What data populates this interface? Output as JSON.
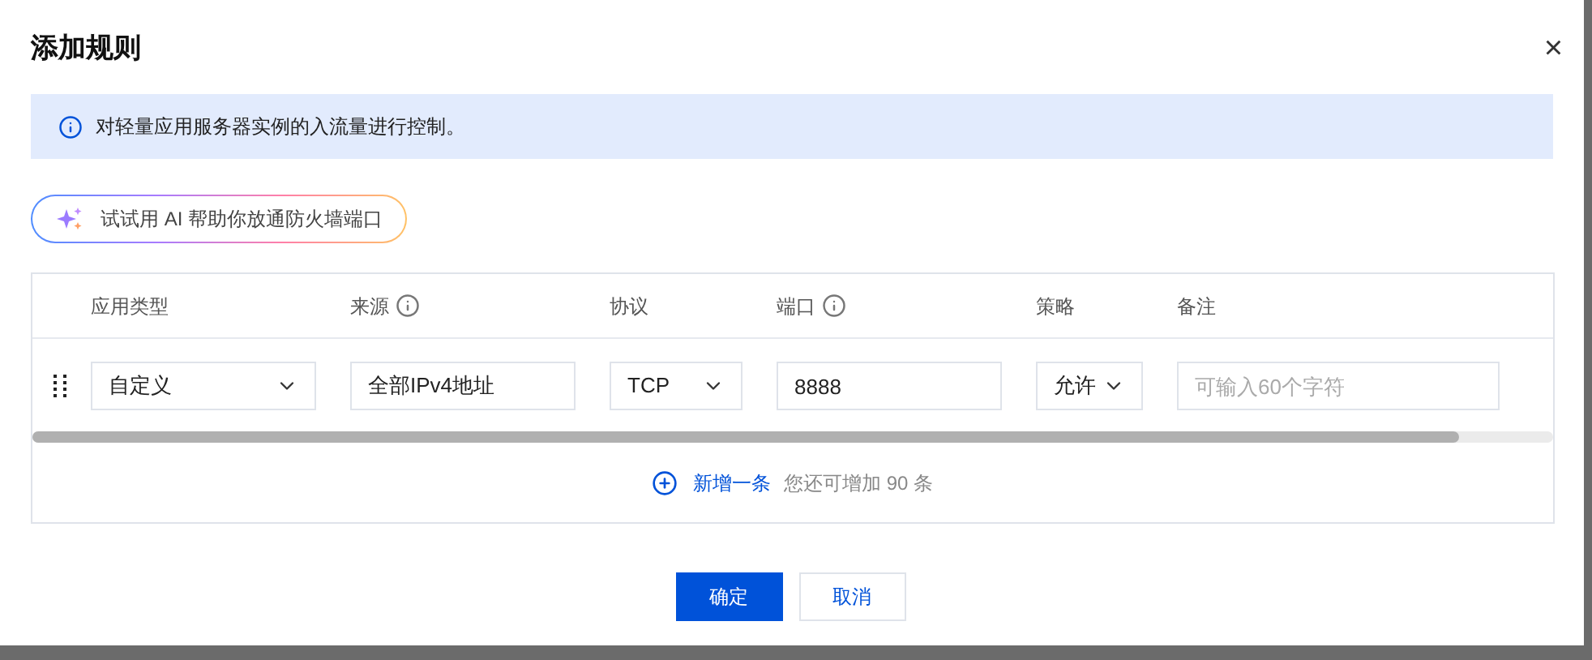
{
  "dialog": {
    "title": "添加规则",
    "close": "×"
  },
  "notice": "对轻量应用服务器实例的入流量进行控制。",
  "ai_button": "试试用 AI 帮助你放通防火墙端口",
  "table": {
    "columns": [
      {
        "label": "应用类型",
        "info": false
      },
      {
        "label": "来源",
        "info": true
      },
      {
        "label": "协议",
        "info": false
      },
      {
        "label": "端口",
        "info": true
      },
      {
        "label": "策略",
        "info": false
      },
      {
        "label": "备注",
        "info": false
      }
    ],
    "rows": [
      {
        "cells": [
          {
            "kind": "select",
            "value": "自定义"
          },
          {
            "kind": "input",
            "value": "全部IPv4地址"
          },
          {
            "kind": "select",
            "value": "TCP"
          },
          {
            "kind": "input",
            "value": "8888"
          },
          {
            "kind": "select",
            "value": "允许"
          },
          {
            "kind": "input",
            "placeholder": "可输入60个字符"
          }
        ]
      }
    ]
  },
  "add_row": {
    "label": "新增一条",
    "hint": "您还可增加 90 条"
  },
  "buttons": [
    {
      "label": "确定",
      "kind": "primary"
    },
    {
      "label": "取消",
      "kind": "secondary"
    }
  ]
}
